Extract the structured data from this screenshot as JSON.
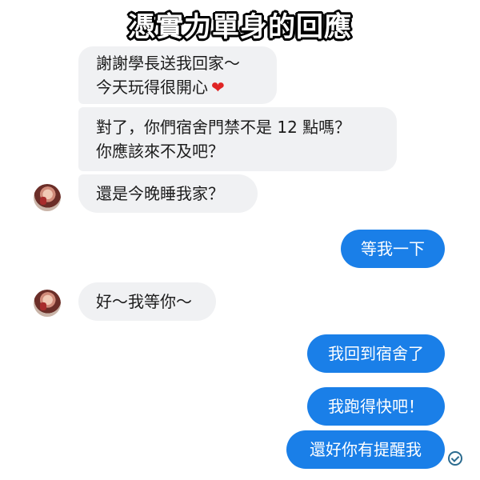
{
  "title": "憑實力單身的回應",
  "messages": [
    {
      "sender": "other",
      "lines": [
        "謝謝學長送我回家～",
        "今天玩得很開心"
      ],
      "emoji": "❤"
    },
    {
      "sender": "other",
      "lines": [
        "對了，你們宿舍門禁不是 12 點嗎？",
        "你應該來不及吧？"
      ]
    },
    {
      "sender": "other",
      "lines": [
        "還是今晚睡我家？"
      ]
    },
    {
      "sender": "me",
      "lines": [
        "等我一下"
      ]
    },
    {
      "sender": "other",
      "lines": [
        "好～我等你～"
      ]
    },
    {
      "sender": "me",
      "lines": [
        "我回到宿舍了"
      ]
    },
    {
      "sender": "me",
      "lines": [
        "我跑得快吧！"
      ]
    },
    {
      "sender": "me",
      "lines": [
        "還好你有提醒我"
      ]
    }
  ],
  "colors": {
    "incoming_bubble": "#f0f1f3",
    "outgoing_bubble": "#1a7fe8",
    "heart": "#e02424"
  },
  "icons": {
    "avatar": "contact-avatar",
    "read_receipt": "read-receipt-icon"
  }
}
